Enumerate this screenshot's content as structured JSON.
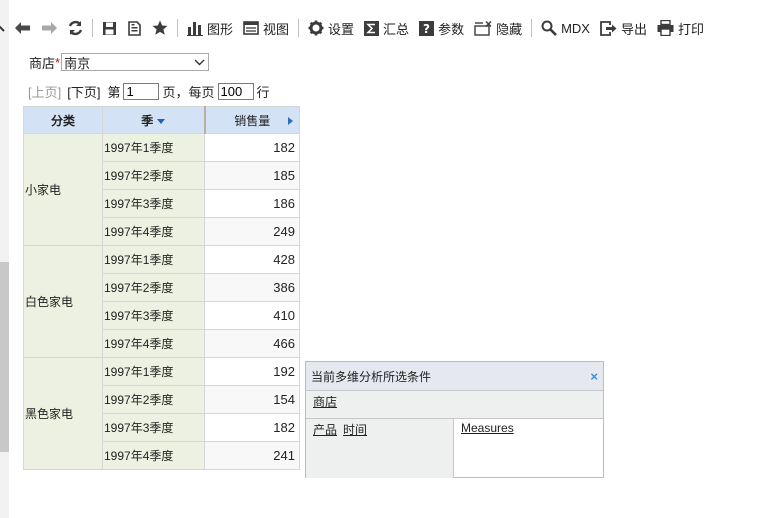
{
  "toolbar": {
    "back_icon": "arrow-left-icon",
    "forward_icon": "arrow-right-icon",
    "refresh_icon": "refresh-icon",
    "save_icon": "save-icon",
    "save_as_icon": "save-as-icon",
    "favorite_icon": "star-icon",
    "chart_label": "图形",
    "view_label": "视图",
    "settings_label": "设置",
    "summary_label": "汇总",
    "params_label": "参数",
    "hide_label": "隐藏",
    "mdx_label": "MDX",
    "export_label": "导出",
    "print_label": "打印"
  },
  "filter": {
    "label": "商店",
    "required_mark": "*",
    "value": "南京"
  },
  "pager": {
    "prev_label": "[上页]",
    "next_label": "[下页]",
    "page_prefix": "第",
    "page_value": "1",
    "page_suffix": "页，每页",
    "page_size_value": "100",
    "rows_suffix": "行"
  },
  "grid": {
    "headers": {
      "category": "分类",
      "season": "季",
      "measure": "销售量"
    },
    "groups": [
      {
        "category": "小家电",
        "rows": [
          {
            "season": "1997年1季度",
            "value": "182"
          },
          {
            "season": "1997年2季度",
            "value": "185"
          },
          {
            "season": "1997年3季度",
            "value": "186"
          },
          {
            "season": "1997年4季度",
            "value": "249"
          }
        ]
      },
      {
        "category": "白色家电",
        "rows": [
          {
            "season": "1997年1季度",
            "value": "428"
          },
          {
            "season": "1997年2季度",
            "value": "386"
          },
          {
            "season": "1997年3季度",
            "value": "410"
          },
          {
            "season": "1997年4季度",
            "value": "466"
          }
        ]
      },
      {
        "category": "黑色家电",
        "rows": [
          {
            "season": "1997年1季度",
            "value": "192"
          },
          {
            "season": "1997年2季度",
            "value": "154"
          },
          {
            "season": "1997年3季度",
            "value": "182"
          },
          {
            "season": "1997年4季度",
            "value": "241"
          }
        ]
      }
    ]
  },
  "conditions": {
    "title": "当前多维分析所选条件",
    "close_glyph": "×",
    "filter_dims": [
      "商店"
    ],
    "row_dims": [
      "产品",
      "时间"
    ],
    "column_dims": [
      "Measures"
    ]
  },
  "colors": {
    "header_bg": "#d3e2f4",
    "dim_cell_bg": "#edf1e1",
    "accent_blue": "#1e64b4"
  }
}
